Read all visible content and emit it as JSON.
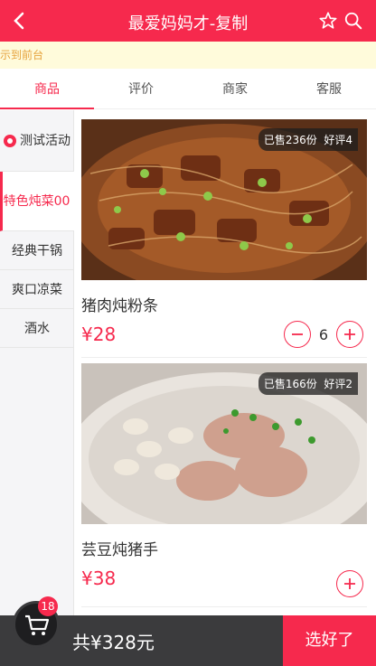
{
  "header": {
    "title": "最爱妈妈才-复制",
    "back_icon": "chevron-left-icon",
    "star_icon": "star-icon",
    "search_icon": "search-icon"
  },
  "notice": {
    "text": "示到前台"
  },
  "tabs": [
    {
      "label": "商品",
      "active": true
    },
    {
      "label": "评价",
      "active": false
    },
    {
      "label": "商家",
      "active": false
    },
    {
      "label": "客服",
      "active": false
    }
  ],
  "categories": [
    {
      "label": "测试活动"
    },
    {
      "label": "特色炖菜00",
      "active": true
    },
    {
      "label": "经典干锅"
    },
    {
      "label": "爽口凉菜"
    },
    {
      "label": "酒水"
    }
  ],
  "goods": [
    {
      "name": "猪肉炖粉条",
      "price": "¥28",
      "sold": "已售236份",
      "rating": "好评4",
      "qty": "6"
    },
    {
      "name": "芸豆炖猪手",
      "price": "¥38",
      "sold": "已售166份",
      "rating": "好评2",
      "qty": ""
    }
  ],
  "footer": {
    "total": "共¥328元",
    "choose": "选好了",
    "cart_count": "18"
  },
  "colors": {
    "accent": "#f6294d",
    "notice_bg": "#fffbdb",
    "footer_bg": "#3b3b3d"
  }
}
